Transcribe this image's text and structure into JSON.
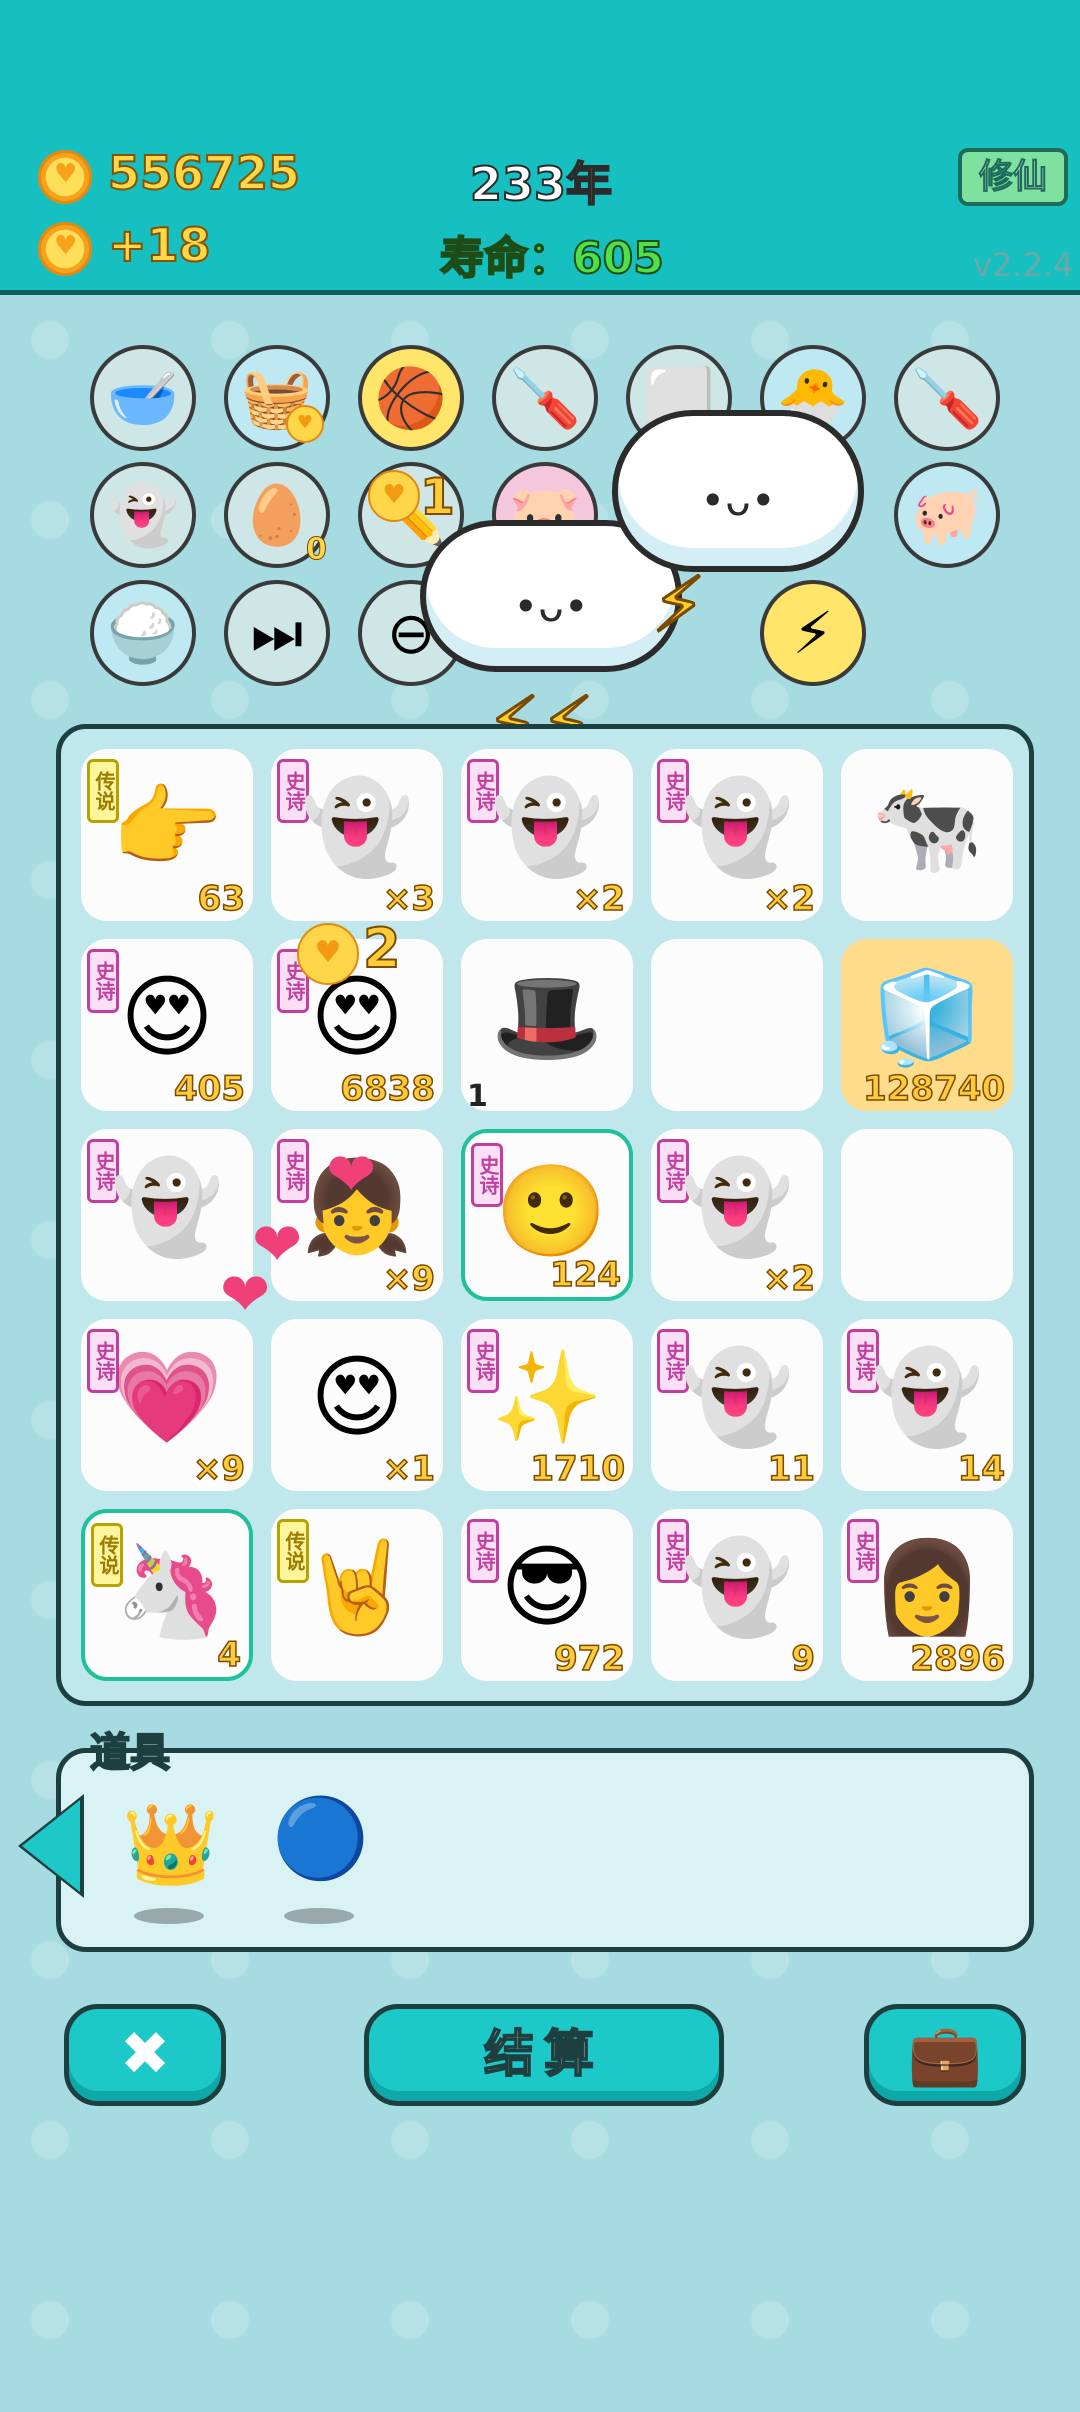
{
  "header": {
    "coins": "556725",
    "coin_rate": "+18",
    "year": "233年",
    "lifespan": "寿命：605",
    "cultivate_button": "修仙",
    "version": "v2.2.4"
  },
  "floating_numbers": [
    "1",
    "2",
    "1"
  ],
  "grid": [
    {
      "rank": "传说",
      "count": "63"
    },
    {
      "rank": "史诗",
      "count": "×3"
    },
    {
      "rank": "史诗",
      "count": "×2"
    },
    {
      "rank": "史诗",
      "count": "×2"
    },
    {
      "rank": "",
      "count": ""
    },
    {
      "rank": "史诗",
      "count": "405"
    },
    {
      "rank": "史诗",
      "count": "6838"
    },
    {
      "rank": "",
      "count": ""
    },
    {
      "rank": "",
      "count": ""
    },
    {
      "rank": "",
      "count": "128740"
    },
    {
      "rank": "史诗",
      "count": ""
    },
    {
      "rank": "史诗",
      "count": "×9"
    },
    {
      "rank": "史诗",
      "count": "124"
    },
    {
      "rank": "史诗",
      "count": "×2"
    },
    {
      "rank": "",
      "count": ""
    },
    {
      "rank": "史诗",
      "count": "×9"
    },
    {
      "rank": "",
      "count": "×1"
    },
    {
      "rank": "史诗",
      "count": "1710"
    },
    {
      "rank": "史诗",
      "count": "11"
    },
    {
      "rank": "史诗",
      "count": "14"
    },
    {
      "rank": "传说",
      "count": "4"
    },
    {
      "rank": "传说",
      "count": ""
    },
    {
      "rank": "史诗",
      "count": "972"
    },
    {
      "rank": "史诗",
      "count": "9"
    },
    {
      "rank": "史诗",
      "count": "2896"
    }
  ],
  "item_badge_zero": "0",
  "tools": {
    "title": "道具"
  },
  "buttons": {
    "settle": "结算"
  }
}
